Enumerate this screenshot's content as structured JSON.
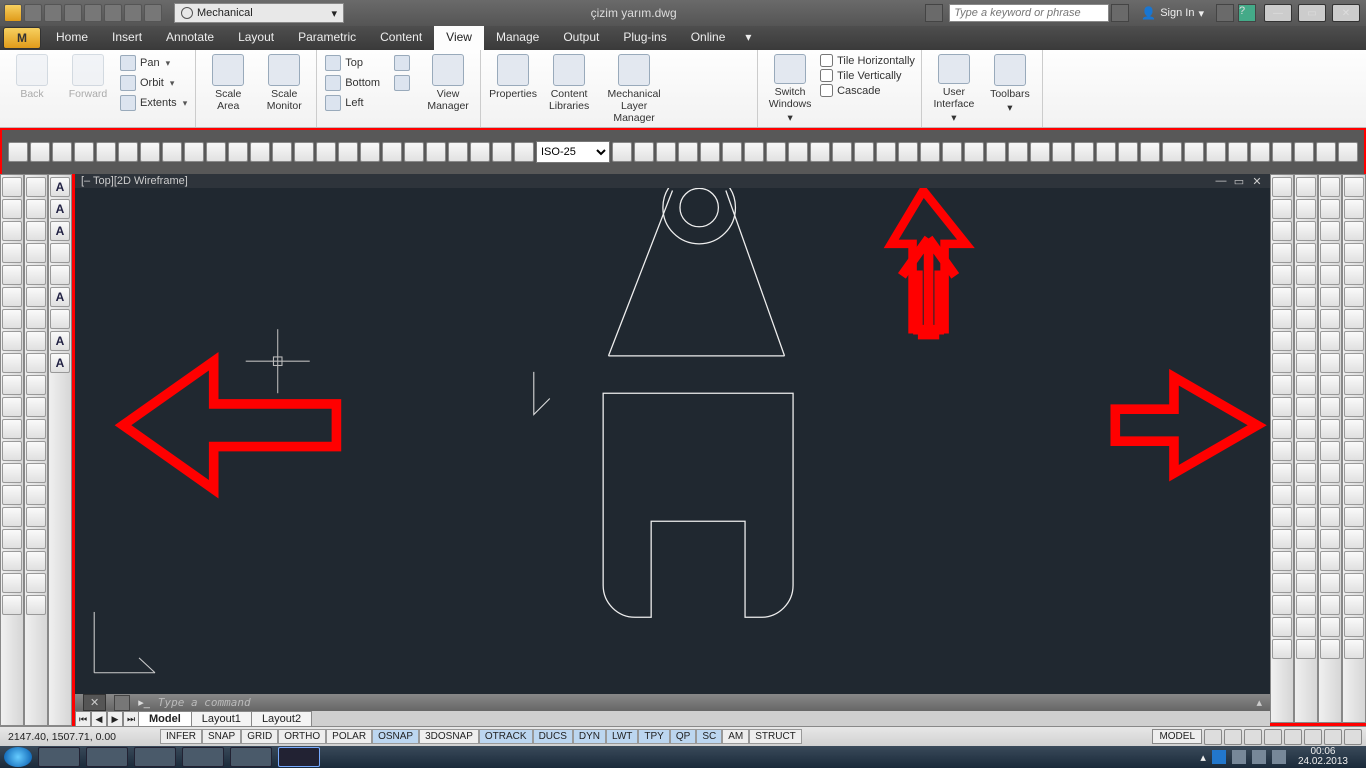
{
  "title_doc": "çizim yarım.dwg",
  "workspace_selector": "Mechanical",
  "help_placeholder": "Type a keyword or phrase",
  "signin": "Sign In",
  "tabs": [
    "Home",
    "Insert",
    "Annotate",
    "Layout",
    "Parametric",
    "Content",
    "View",
    "Manage",
    "Output",
    "Plug-ins",
    "Online"
  ],
  "active_tab": "View",
  "ribbon": {
    "back": "Back",
    "forward": "Forward",
    "pan": "Pan",
    "orbit": "Orbit",
    "extents": "Extents",
    "scale_area": "Scale\nArea",
    "scale_monitor": "Scale\nMonitor",
    "top": "Top",
    "bottom": "Bottom",
    "left": "Left",
    "view_manager": "View\nManager",
    "properties": "Properties",
    "content_libraries": "Content\nLibraries",
    "mech_layer": "Mechanical\nLayer Manager",
    "switch_windows": "Switch\nWindows",
    "tile_h": "Tile Horizontally",
    "tile_v": "Tile Vertically",
    "cascade": "Cascade",
    "user_interface": "User\nInterface",
    "toolbars": "Toolbars"
  },
  "dimstyle": "ISO-25",
  "viewport_label": "[– Top][2D Wireframe]",
  "command_placeholder": "Type a command",
  "doc_tabs": [
    "Model",
    "Layout1",
    "Layout2"
  ],
  "active_doc_tab": "Model",
  "coords": "2147.40, 1507.71, 0.00",
  "status_toggles": [
    "INFER",
    "SNAP",
    "GRID",
    "ORTHO",
    "POLAR",
    "OSNAP",
    "3DOSNAP",
    "OTRACK",
    "DUCS",
    "DYN",
    "LWT",
    "TPY",
    "QP",
    "SC",
    "AM",
    "STRUCT"
  ],
  "status_on": [
    "OSNAP",
    "OTRACK",
    "DUCS",
    "DYN",
    "LWT",
    "TPY",
    "QP",
    "SC"
  ],
  "model_badge": "MODEL",
  "clock_time": "00:06",
  "clock_date": "24.02.2013"
}
